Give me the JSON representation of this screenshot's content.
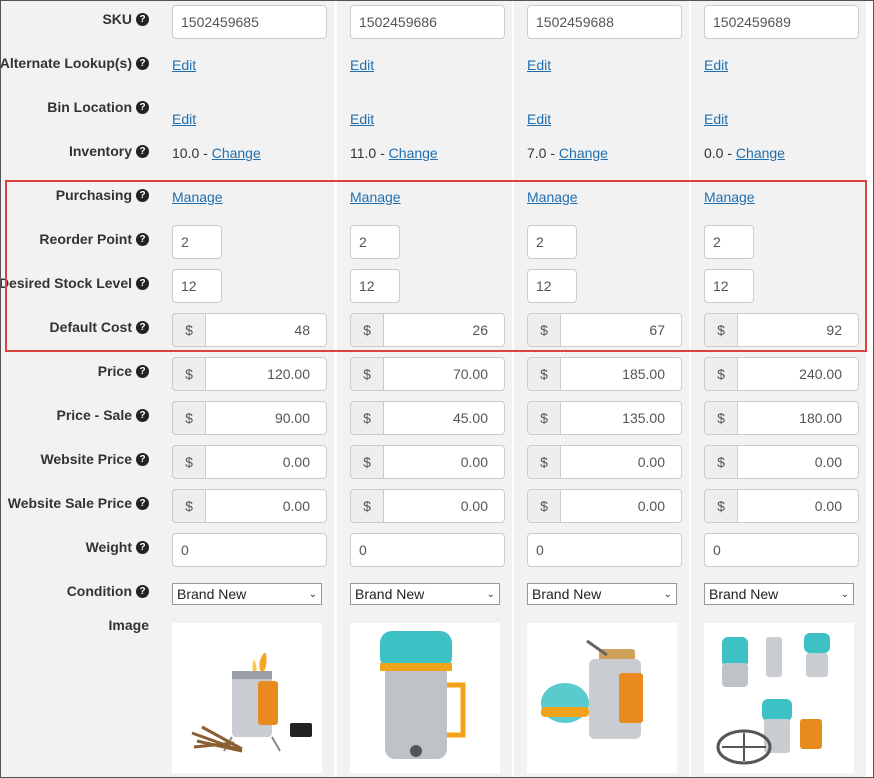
{
  "fields": {
    "sku": "SKU",
    "alternate_lookups": "Alternate Lookup(s)",
    "bin_location": "Bin Location",
    "inventory": "Inventory",
    "purchasing": "Purchasing",
    "reorder_point": "Reorder Point",
    "desired_stock_level": "Desired Stock Level",
    "default_cost": "Default Cost",
    "price": "Price",
    "price_sale": "Price - Sale",
    "website_price": "Website Price",
    "website_sale_price": "Website Sale Price",
    "weight": "Weight",
    "condition": "Condition",
    "image": "Image"
  },
  "help_glyph": "?",
  "currency_symbol": "$",
  "edit_label": "Edit",
  "change_label": "Change",
  "manage_label": "Manage",
  "inventory_separator": " - ",
  "highlight_color": "#d9443f",
  "link_color": "#1f6fb0",
  "products": [
    {
      "sku": "1502459685",
      "inventory": "10.0",
      "reorder_point": "2",
      "desired_stock_level": "12",
      "default_cost": "48",
      "price": "120.00",
      "price_sale": "90.00",
      "website_price": "0.00",
      "website_sale_price": "0.00",
      "weight": "0",
      "condition": "Brand New",
      "image": "campstove-with-wood-and-phone"
    },
    {
      "sku": "1502459686",
      "inventory": "11.0",
      "reorder_point": "2",
      "desired_stock_level": "12",
      "default_cost": "26",
      "price": "70.00",
      "price_sale": "45.00",
      "website_price": "0.00",
      "website_sale_price": "0.00",
      "weight": "0",
      "condition": "Brand New",
      "image": "kettle-pot-teal-lid"
    },
    {
      "sku": "1502459688",
      "inventory": "7.0",
      "reorder_point": "2",
      "desired_stock_level": "12",
      "default_cost": "67",
      "price": "185.00",
      "price_sale": "135.00",
      "website_price": "0.00",
      "website_sale_price": "0.00",
      "weight": "0",
      "condition": "Brand New",
      "image": "stove-with-cookset"
    },
    {
      "sku": "1502459689",
      "inventory": "0.0",
      "reorder_point": "2",
      "desired_stock_level": "12",
      "default_cost": "92",
      "price": "240.00",
      "price_sale": "180.00",
      "website_price": "0.00",
      "website_sale_price": "0.00",
      "weight": "0",
      "condition": "Brand New",
      "image": "bundle-stove-grill-kettle"
    }
  ]
}
